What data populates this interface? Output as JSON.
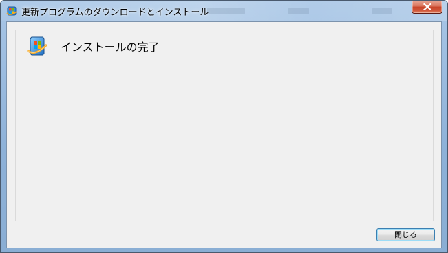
{
  "window": {
    "title": "更新プログラムのダウンロードとインストール",
    "icon": "windows-update-icon",
    "close_glyph": "close-icon"
  },
  "main": {
    "heading": "インストールの完了",
    "heading_icon": "windows-update-icon"
  },
  "footer": {
    "close_label": "閉じる"
  },
  "colors": {
    "client_bg": "#f0f0f0",
    "close_accent": "#c8452a",
    "titlebar": "#9dbde0"
  }
}
